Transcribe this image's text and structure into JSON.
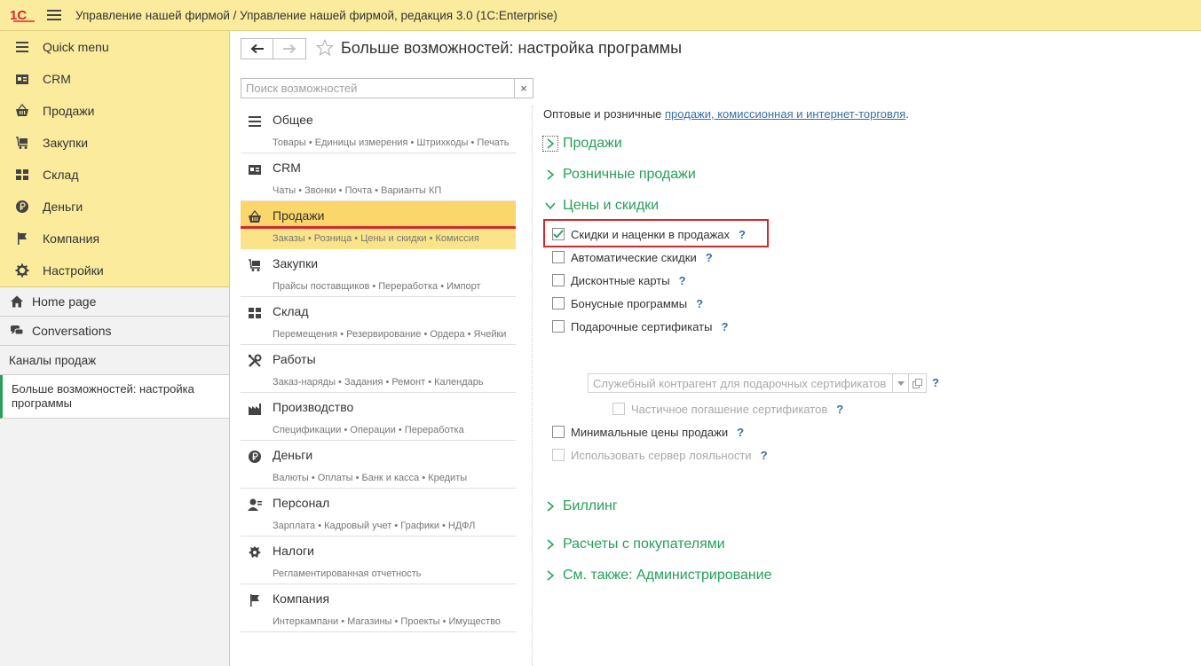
{
  "app": {
    "logo_text": "1С",
    "title": "Управление нашей фирмой / Управление нашей фирмой, редакция 3.0  (1С:Enterprise)"
  },
  "sidebar": {
    "sections": [
      {
        "label": "Quick menu",
        "icon": "menu-icon"
      },
      {
        "label": "CRM",
        "icon": "contact-card-icon"
      },
      {
        "label": "Продажи",
        "icon": "basket-icon"
      },
      {
        "label": "Закупки",
        "icon": "cart-icon"
      },
      {
        "label": "Склад",
        "icon": "warehouse-grid-icon"
      },
      {
        "label": "Деньги",
        "icon": "ruble-icon"
      },
      {
        "label": "Компания",
        "icon": "flag-icon"
      },
      {
        "label": "Настройки",
        "icon": "gear-icon"
      }
    ],
    "home": "Home page",
    "conversations": "Conversations",
    "channels": "Каналы продаж",
    "open_window": "Больше возможностей: настройка программы"
  },
  "header": {
    "title": "Больше возможностей: настройка программы"
  },
  "search": {
    "placeholder": "Поиск возможностей",
    "clear": "×"
  },
  "functions": [
    {
      "name": "Общее",
      "sub": "Товары • Единицы измерения • Штрихкоды • Печать",
      "icon": "list-icon"
    },
    {
      "name": "CRM",
      "sub": "Чаты • Звонки • Почта • Варианты КП",
      "icon": "contact-card-icon"
    },
    {
      "name": "Продажи",
      "sub": "Заказы • Розница • Цены и скидки • Комиссия",
      "icon": "basket-icon"
    },
    {
      "name": "Закупки",
      "sub": "Прайсы поставщиков • Переработка • Импорт",
      "icon": "cart-icon"
    },
    {
      "name": "Склад",
      "sub": "Перемещения • Резервирование • Ордера • Ячейки",
      "icon": "warehouse-grid-icon"
    },
    {
      "name": "Работы",
      "sub": "Заказ-наряды • Задания • Ремонт • Календарь",
      "icon": "tools-icon"
    },
    {
      "name": "Производство",
      "sub": "Спецификации • Операции • Переработка",
      "icon": "factory-icon"
    },
    {
      "name": "Деньги",
      "sub": "Валюты • Оплаты • Банк и касса • Кредиты",
      "icon": "ruble-icon"
    },
    {
      "name": "Персонал",
      "sub": "Зарплата • Кадровый учет • Графики • НДФЛ",
      "icon": "person-icon"
    },
    {
      "name": "Налоги",
      "sub": "Регламентированная отчетность",
      "icon": "emblem-icon"
    },
    {
      "name": "Компания",
      "sub": "Интеркампани • Магазины • Проекты • Имущество",
      "icon": "flag-icon"
    }
  ],
  "panel": {
    "intro_text": "Оптовые и розничные ",
    "intro_link": "продажи, комиссионная и интернет-торговля",
    "intro_end": ".",
    "groups": {
      "sales": "Продажи",
      "retail": "Розничные продажи",
      "prices": "Цены и скидки",
      "billing": "Биллинг",
      "settlements": "Расчеты с покупателями",
      "see_also": "См. также: Администрирование"
    },
    "options": {
      "discounts": {
        "label": "Скидки и наценки в продажах",
        "checked": true
      },
      "auto": {
        "label": "Автоматические скидки",
        "checked": false
      },
      "cards": {
        "label": "Дисконтные карты",
        "checked": false
      },
      "bonus": {
        "label": "Бонусные программы",
        "checked": false
      },
      "gift": {
        "label": "Подарочные сертификаты",
        "checked": false
      },
      "gift_partial": {
        "label": "Частичное погашение сертификатов",
        "checked": false
      },
      "min_prices": {
        "label": "Минимальные цены продажи",
        "checked": false
      },
      "loyalty": {
        "label": "Использовать сервер лояльности",
        "checked": false
      }
    },
    "gift_counterparty_placeholder": "Служебный контрагент для подарочных сертификатов",
    "help": "?"
  },
  "colors": {
    "accent_yellow": "#fbec9d",
    "group_green": "#26a05a",
    "highlight_red": "#d7262c",
    "link_blue": "#3a6ea5"
  }
}
